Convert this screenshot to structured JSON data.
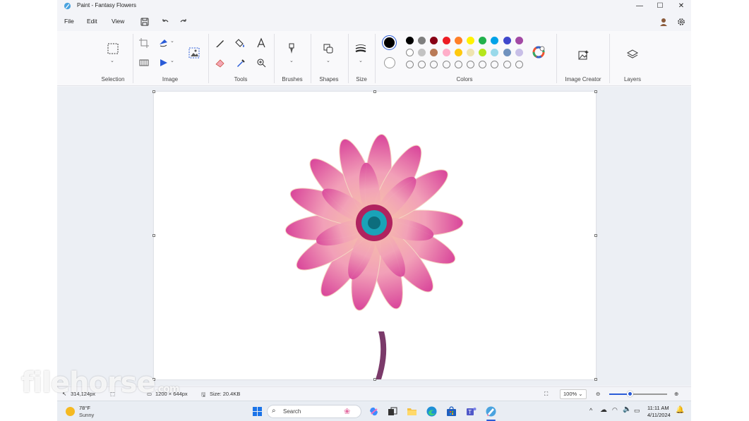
{
  "window": {
    "title": "Paint - Fantasy Flowers",
    "controls": {
      "minimize": "—",
      "maximize": "☐",
      "close": "✕"
    }
  },
  "menu": {
    "file": "File",
    "edit": "Edit",
    "view": "View"
  },
  "ribbon": {
    "groups": {
      "selection": "Selection",
      "image": "Image",
      "tools": "Tools",
      "brushes": "Brushes",
      "shapes": "Shapes",
      "size": "Size",
      "colors": "Colors",
      "image_creator": "Image Creator",
      "layers": "Layers"
    },
    "colors": {
      "primary": "#000000",
      "secondary": "#ffffff",
      "row1": [
        "#000000",
        "#7f7f7f",
        "#880015",
        "#ed1c24",
        "#ff7f27",
        "#fff200",
        "#22b14c",
        "#00a2e8",
        "#3f48cc",
        "#a349a4"
      ],
      "row2": [
        "#ffffff",
        "#c3c3c3",
        "#b97a57",
        "#ffaec9",
        "#ffc90e",
        "#efe4b0",
        "#b5e61d",
        "#99d9ea",
        "#7092be",
        "#c8bfe7"
      ],
      "row3_empty": 10
    }
  },
  "status": {
    "cursor_pos": "314,124px",
    "dimensions": "1200 × 644px",
    "file_size": "Size: 20.4KB",
    "zoom": "100%",
    "zoom_fraction": 0.35
  },
  "taskbar": {
    "weather_temp": "78°F",
    "weather_cond": "Sunny",
    "search_label": "Search",
    "time": "11:11 AM",
    "date": "4/11/2024"
  },
  "watermark": {
    "brand": "filehorse",
    "tld": ".com"
  },
  "icons": [
    "paint-app-icon",
    "save-icon",
    "undo-icon",
    "redo-icon",
    "profile-icon",
    "settings-icon",
    "select-icon",
    "crop-icon",
    "resize-icon",
    "rotate-icon",
    "flip-icon",
    "image-background-icon",
    "pencil-icon",
    "fill-icon",
    "text-icon",
    "eraser-icon",
    "color-picker-icon",
    "magnifier-icon",
    "brush-icon",
    "shapes-icon",
    "size-icon",
    "edit-colors-icon",
    "image-creator-icon",
    "layers-icon"
  ]
}
